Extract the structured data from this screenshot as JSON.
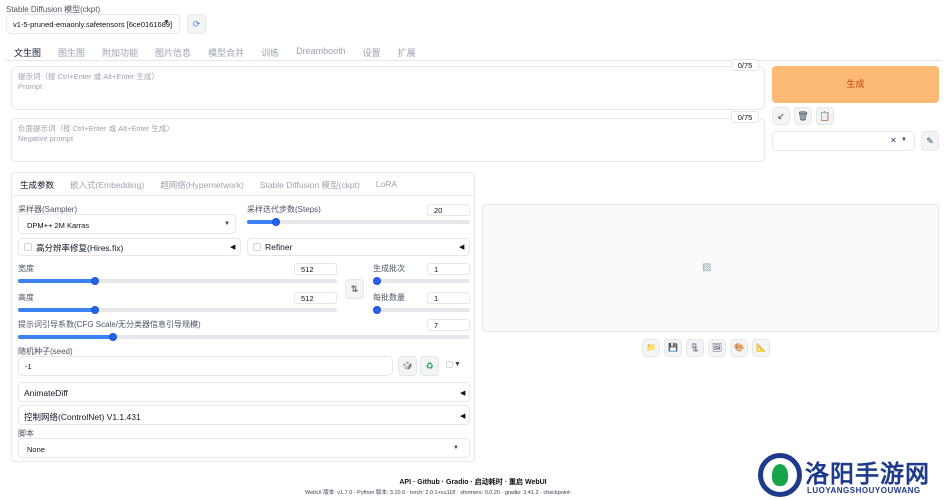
{
  "checkpoint": {
    "label": "Stable Diffusion 模型(ckpt)",
    "value": "v1-5-pruned-emaonly.safetensors [6ce0161689]"
  },
  "main_tabs": [
    "文生图",
    "图生图",
    "附加功能",
    "图片信息",
    "模型合并",
    "训练",
    "Dreambooth",
    "设置",
    "扩展"
  ],
  "prompt": {
    "placeholder_line1": "提示词（按 Ctrl+Enter 或 Alt+Enter 生成）",
    "placeholder_line2": "Prompt",
    "counter": "0/75"
  },
  "negative": {
    "placeholder_line1": "负面提示词（按 Ctrl+Enter 或 Alt+Enter 生成）",
    "placeholder_line2": "Negative prompt",
    "counter": "0/75"
  },
  "generate_label": "生成",
  "sub_tabs": [
    "生成参数",
    "嵌入式(Embedding)",
    "超网络(Hypernetwork)",
    "Stable Diffusion 模型(ckpt)",
    "LoRA"
  ],
  "sampler": {
    "label": "采样器(Sampler)",
    "value": "DPM++ 2M Karras"
  },
  "steps": {
    "label": "采样迭代步数(Steps)",
    "value": "20",
    "fraction": 0.13
  },
  "hires": {
    "label": "高分辨率修复(Hires.fix)"
  },
  "refiner": {
    "label": "Refiner"
  },
  "width": {
    "label": "宽度",
    "value": "512",
    "fraction": 0.24
  },
  "height": {
    "label": "高度",
    "value": "512",
    "fraction": 0.24
  },
  "batch_count": {
    "label": "生成批次",
    "value": "1",
    "fraction": 0.0
  },
  "batch_size": {
    "label": "每批数量",
    "value": "1",
    "fraction": 0.0
  },
  "cfg": {
    "label": "提示词引导系数(CFG Scale/无分类器信息引导规模)",
    "value": "7",
    "fraction": 0.21
  },
  "seed": {
    "label": "随机种子(seed)",
    "value": "-1"
  },
  "animatediff": {
    "label": "AnimateDiff"
  },
  "controlnet": {
    "label": "控制网络(ControlNet) V1.1.431"
  },
  "script": {
    "label": "脚本",
    "value": "None"
  },
  "footer": {
    "links": "API · Github · Gradio · 启动耗时 · 重启 WebUI",
    "versions": "WebUI 版本: v1.7.0 · Python 版本: 3.10.6 · torch: 2.0.1+cu118 · xformers: 0.0.20 · gradio: 3.41.2 · checkpoint:"
  },
  "watermark": {
    "title": "洛阳手游网",
    "subtitle": "LUOYANGSHOUYOUWANG"
  },
  "colors": {
    "accent": "#2563eb",
    "generate": "#fdba74"
  }
}
